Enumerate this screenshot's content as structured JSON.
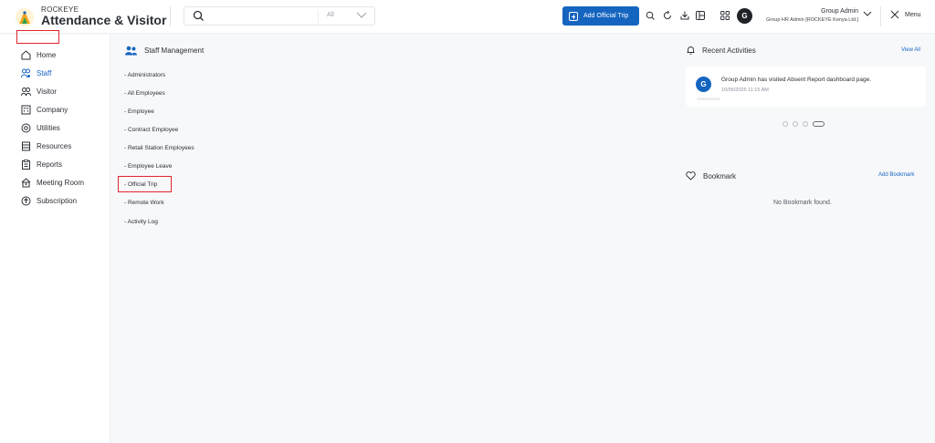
{
  "brand": {
    "small": "ROCKEYE",
    "big": "Attendance & Visitor"
  },
  "search": {
    "scope": "All"
  },
  "toolbar": {
    "add_trip_label": "Add Official Trip"
  },
  "user": {
    "avatar": "G",
    "name": "Group Admin",
    "role": "Group HR Admin [ROCKEYE Kenya Ltd.]"
  },
  "menu": {
    "label": "Menu"
  },
  "sidebar": {
    "items": [
      {
        "label": "Home",
        "icon": "home-icon"
      },
      {
        "label": "Staff",
        "icon": "staff-icon"
      },
      {
        "label": "Visitor",
        "icon": "visitor-icon"
      },
      {
        "label": "Company",
        "icon": "company-icon"
      },
      {
        "label": "Utilities",
        "icon": "utilities-icon"
      },
      {
        "label": "Resources",
        "icon": "resources-icon"
      },
      {
        "label": "Reports",
        "icon": "reports-icon"
      },
      {
        "label": "Meeting Room",
        "icon": "meeting-room-icon"
      },
      {
        "label": "Subscription",
        "icon": "subscription-icon"
      }
    ]
  },
  "staff_management": {
    "title": "Staff Management",
    "links": [
      "- Administrators",
      "- All Employees",
      "- Employee",
      "- Contract Employee",
      "- Retail Station Employees",
      "- Employee Leave",
      "- Official Trip",
      "- Remote Work",
      "- Activity Log"
    ]
  },
  "recent_activities": {
    "title": "Recent Activities",
    "view_all": "View All",
    "items": [
      {
        "avatar": "G",
        "text": "Group Admin has visited Absent Report dashboard page.",
        "time": "10/06/2025 11:15 AM"
      }
    ]
  },
  "bookmark": {
    "title": "Bookmark",
    "add_label": "Add Bookmark",
    "empty_text": "No Bookmark found."
  },
  "colors": {
    "accent": "#1565c0",
    "highlight": "#e0262d"
  }
}
